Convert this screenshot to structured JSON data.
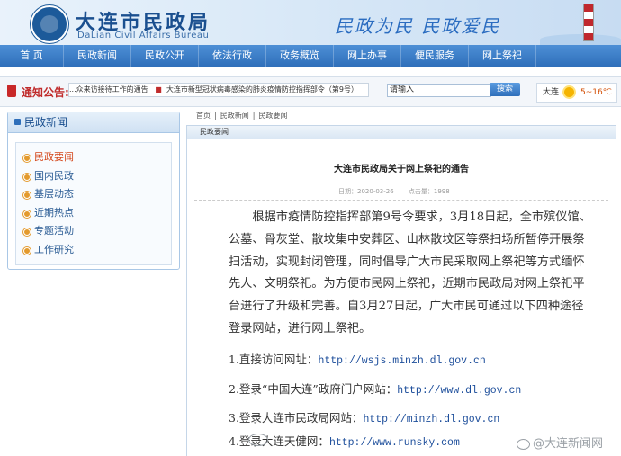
{
  "site": {
    "title": "大连市民政局",
    "subtitle": "DaLian Civil Affairs Bureau",
    "slogan": "民政为民 民政爱民"
  },
  "nav": {
    "items": [
      "首 页",
      "民政新闻",
      "民政公开",
      "依法行政",
      "政务概览",
      "网上办事",
      "便民服务",
      "网上祭祀"
    ]
  },
  "notice": {
    "label": "通知公告:",
    "items": [
      "...众来访接待工作的通告",
      "大连市新型冠状病毒感染的肺炎疫情防控指挥部令（第9号）"
    ]
  },
  "search": {
    "value": "请输入",
    "button": "搜索"
  },
  "weather": {
    "city": "大连",
    "temp": "5~16℃"
  },
  "sidebar": {
    "title": "民政新闻",
    "items": [
      "民政要闻",
      "国内民政",
      "基层动态",
      "近期热点",
      "专题活动",
      "工作研究"
    ]
  },
  "breadcrumb": [
    "首页",
    "民政新闻",
    "民政要闻"
  ],
  "content": {
    "section": "民政要闻",
    "title": "大连市民政局关于网上祭祀的通告",
    "date_label": "日期：",
    "date": "2020-03-26",
    "clicks_label": "点击量：",
    "clicks": "1998",
    "body": "根据市疫情防控指挥部第9号令要求，3月18日起，全市殡仪馆、公墓、骨灰堂、散坟集中安葬区、山林散坟区等祭扫场所暂停开展祭扫活动，实现封闭管理，同时倡导广大市民采取网上祭祀等方式缅怀先人、文明祭祀。为方便市民网上祭祀，近期市民政局对网上祭祀平台进行了升级和完善。自3月27日起，广大市民可通过以下四种途径登录网站，进行网上祭祀。",
    "list": [
      {
        "text": "1.直接访问网址：",
        "url": "http://wsjs.minzh.dl.gov.cn"
      },
      {
        "text": "2.登录“中国大连”政府门户网站：",
        "url": "http://www.dl.gov.cn"
      },
      {
        "text": "3.登录大连市民政局网站：",
        "url": "http://minzh.dl.gov.cn"
      },
      {
        "text": "4.登录大连天健网：",
        "url": "http://www.runsky.com"
      }
    ]
  },
  "watermark": "@大连新闻网"
}
